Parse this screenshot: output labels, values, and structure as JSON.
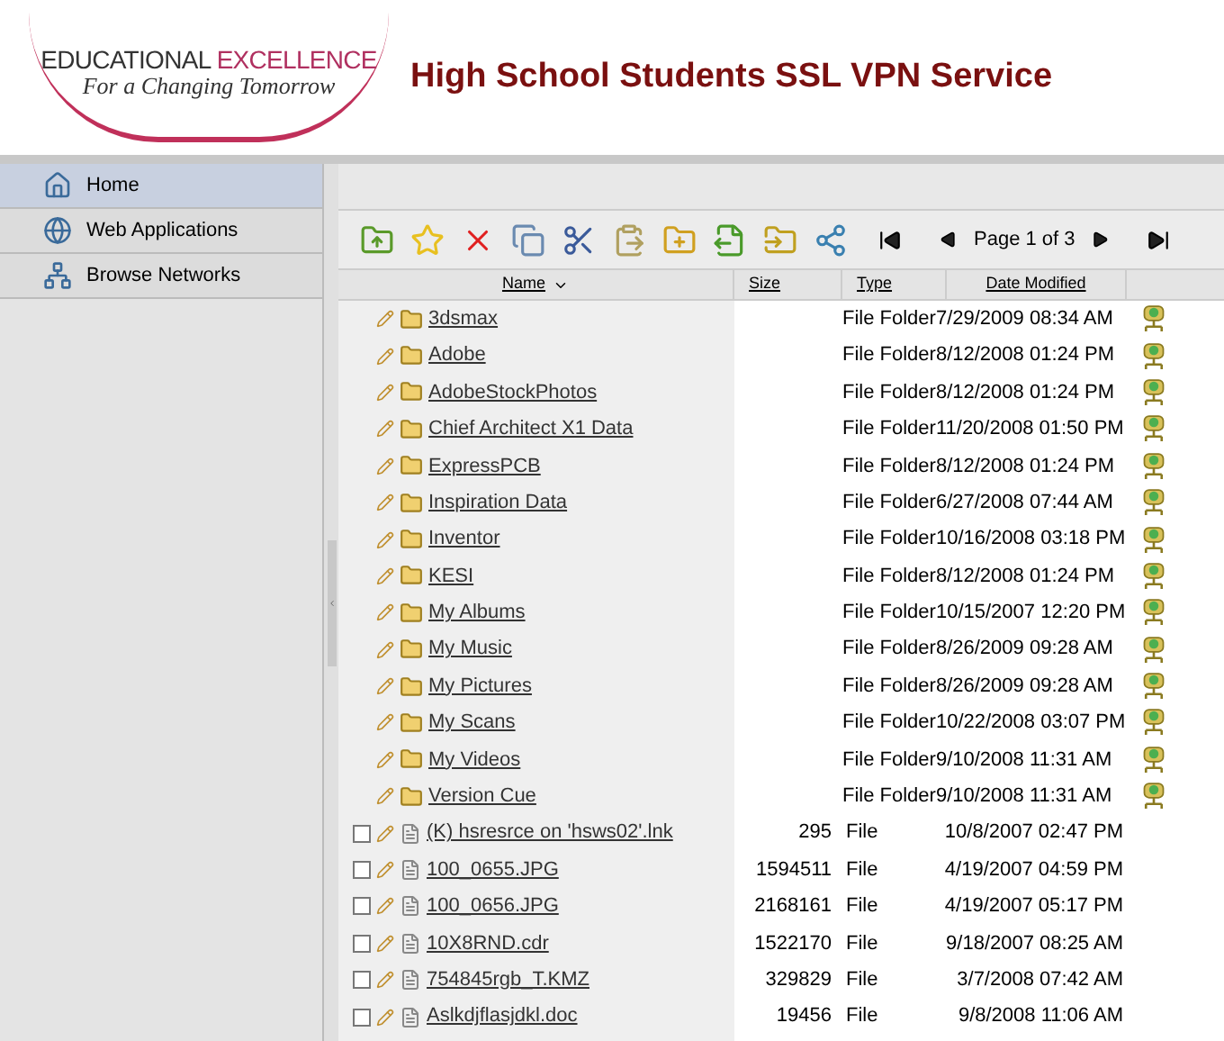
{
  "logo": {
    "line_1a": "EDUCATIONAL",
    "line_1b": "EXCELLENCE",
    "tagline": "For a Changing Tomorrow"
  },
  "title": "High School Students SSL VPN Service",
  "sidebar": {
    "items": [
      {
        "label": "Home",
        "selected": true
      },
      {
        "label": "Web Applications",
        "selected": false
      },
      {
        "label": "Browse Networks",
        "selected": false
      }
    ]
  },
  "pager": {
    "label": "Page 1 of 3"
  },
  "table": {
    "columns": [
      {
        "label": "Name",
        "sorted": true
      },
      {
        "label": "Size",
        "sorted": false
      },
      {
        "label": "Type",
        "sorted": false
      },
      {
        "label": "Date Modified",
        "sorted": false
      }
    ],
    "rows": [
      {
        "kind": "folder",
        "name": "3dsmax",
        "type": "File Folder",
        "date": "7/29/2009 08:34 AM"
      },
      {
        "kind": "folder",
        "name": "Adobe",
        "type": "File Folder",
        "date": "8/12/2008 01:24 PM"
      },
      {
        "kind": "folder",
        "name": "AdobeStockPhotos",
        "type": "File Folder",
        "date": "8/12/2008 01:24 PM"
      },
      {
        "kind": "folder",
        "name": "Chief Architect X1 Data",
        "type": "File Folder",
        "date": "11/20/2008 01:50 PM"
      },
      {
        "kind": "folder",
        "name": "ExpressPCB",
        "type": "File Folder",
        "date": "8/12/2008 01:24 PM"
      },
      {
        "kind": "folder",
        "name": "Inspiration Data",
        "type": "File Folder",
        "date": "6/27/2008 07:44 AM"
      },
      {
        "kind": "folder",
        "name": "Inventor",
        "type": "File Folder",
        "date": "10/16/2008 03:18 PM"
      },
      {
        "kind": "folder",
        "name": "KESI",
        "type": "File Folder",
        "date": "8/12/2008 01:24 PM"
      },
      {
        "kind": "folder",
        "name": "My Albums",
        "type": "File Folder",
        "date": "10/15/2007 12:20 PM"
      },
      {
        "kind": "folder",
        "name": "My Music",
        "type": "File Folder",
        "date": "8/26/2009 09:28 AM"
      },
      {
        "kind": "folder",
        "name": "My Pictures",
        "type": "File Folder",
        "date": "8/26/2009 09:28 AM"
      },
      {
        "kind": "folder",
        "name": "My Scans",
        "type": "File Folder",
        "date": "10/22/2008 03:07 PM"
      },
      {
        "kind": "folder",
        "name": "My Videos",
        "type": "File Folder",
        "date": "9/10/2008 11:31 AM"
      },
      {
        "kind": "folder",
        "name": "Version Cue",
        "type": "File Folder",
        "date": "9/10/2008 11:31 AM"
      },
      {
        "kind": "file",
        "name": "(K) hsresrce on 'hsws02'.lnk",
        "size": "295",
        "type": "File",
        "date": "10/8/2007 02:47 PM",
        "checked": false
      },
      {
        "kind": "file",
        "name": "100_0655.JPG",
        "size": "1594511",
        "type": "File",
        "date": "4/19/2007 04:59 PM",
        "checked": false
      },
      {
        "kind": "file",
        "name": "100_0656.JPG",
        "size": "2168161",
        "type": "File",
        "date": "4/19/2007 05:17 PM",
        "checked": false
      },
      {
        "kind": "file",
        "name": "10X8RND.cdr",
        "size": "1522170",
        "type": "File",
        "date": "9/18/2007 08:25 AM",
        "checked": false
      },
      {
        "kind": "file",
        "name": "754845rgb_T.KMZ",
        "size": "329829",
        "type": "File",
        "date": "3/7/2008 07:42 AM",
        "checked": false
      },
      {
        "kind": "file",
        "name": "Aslkdjflasjdkl.doc",
        "size": "19456",
        "type": "File",
        "date": "9/8/2008 11:06 AM",
        "checked": false
      }
    ]
  }
}
